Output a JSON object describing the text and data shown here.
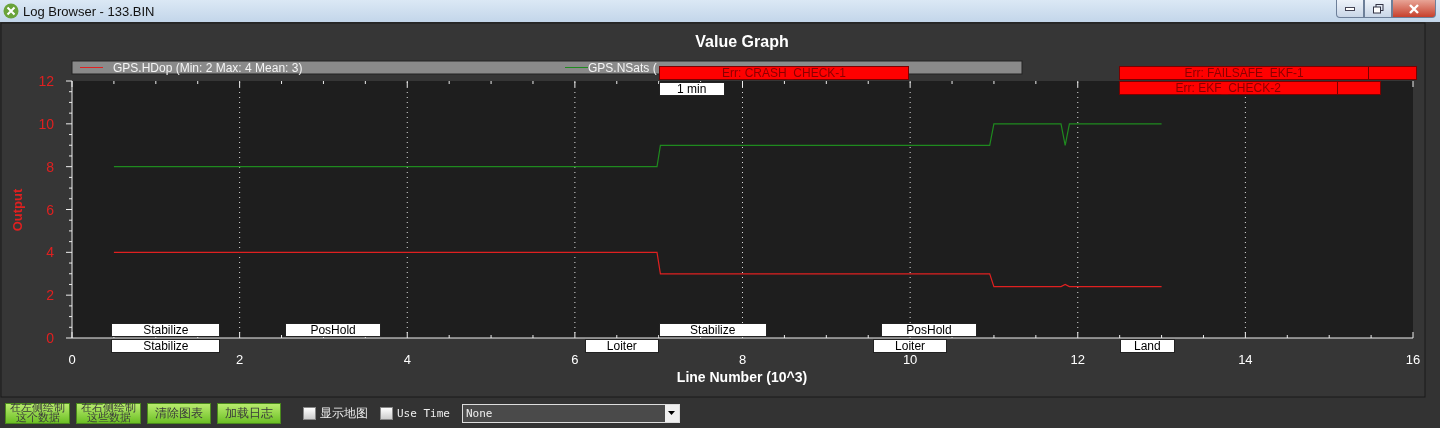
{
  "window": {
    "title": "Log Browser - 133.BIN"
  },
  "graph": {
    "title": "Value Graph",
    "chart_data": {
      "type": "line",
      "xlabel": "Line Number (10^3)",
      "ylabel": "Output",
      "xlim": [
        0,
        16
      ],
      "ylim": [
        0,
        12
      ],
      "xticks": [
        0,
        2,
        4,
        6,
        8,
        10,
        12,
        14,
        16
      ],
      "yticks": [
        0,
        2,
        4,
        6,
        8,
        10,
        12
      ],
      "grid": true,
      "legend": true,
      "x": [
        0.5,
        6.98,
        7.02,
        10.95,
        11.0,
        11.8,
        11.85,
        11.9,
        13.0
      ],
      "series": [
        {
          "name": "GPS.HDop (Min: 2 Max: 4 Mean: 3)",
          "color": "#e02020",
          "values": [
            4,
            4,
            3,
            3,
            2.4,
            2.4,
            2.5,
            2.4,
            2.4
          ]
        },
        {
          "name": "GPS.NSats (",
          "color": "#1f8a1f",
          "values": [
            8,
            8,
            9,
            9,
            10,
            10,
            9,
            10,
            10
          ]
        }
      ]
    },
    "event_labels": [
      {
        "kind": "error",
        "text": "Err: CRASH_CHECK-1"
      },
      {
        "kind": "marker",
        "text": "1 min"
      },
      {
        "kind": "error",
        "text": "Err: FAILSAFE_EKF-1"
      },
      {
        "kind": "error",
        "text": "Err: EKF_CHECK-2"
      },
      {
        "kind": "mode",
        "text": "Stabilize"
      },
      {
        "kind": "mode",
        "text": "Stabilize"
      },
      {
        "kind": "mode",
        "text": "PosHold"
      },
      {
        "kind": "mode",
        "text": "Loiter"
      },
      {
        "kind": "mode",
        "text": "Stabilize"
      },
      {
        "kind": "mode",
        "text": "PosHold"
      },
      {
        "kind": "mode",
        "text": "Loiter"
      },
      {
        "kind": "mode",
        "text": "Land"
      }
    ]
  },
  "toolbar": {
    "buttons": [
      [
        "在左侧绘制",
        "这个数据"
      ],
      [
        "在右侧绘制",
        "这些数据"
      ],
      [
        "清除图表"
      ],
      [
        "加载日志"
      ]
    ],
    "checkboxes": [
      {
        "label": "显示地图",
        "checked": false,
        "kind": "map"
      },
      {
        "label": "Use Time",
        "checked": false,
        "kind": "time"
      }
    ],
    "time_field": {
      "value": "None"
    }
  }
}
